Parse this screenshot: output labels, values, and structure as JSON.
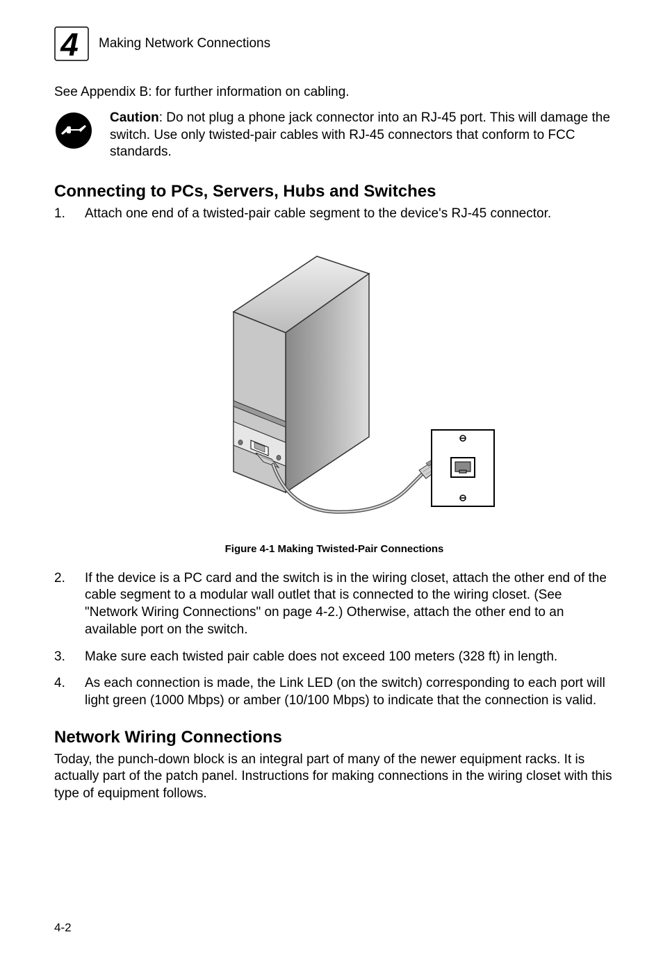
{
  "header": {
    "chapter_number": "4",
    "title": "Making Network Connections"
  },
  "intro": "See Appendix B: for further information on cabling.",
  "caution": {
    "label": "Caution",
    "text": ": Do not plug a phone jack connector into an RJ-45 port. This will damage the switch. Use only twisted-pair cables with RJ-45 connectors that conform to FCC standards."
  },
  "section1": {
    "heading": "Connecting to PCs, Servers, Hubs and Switches",
    "items": [
      {
        "num": "1.",
        "text": "Attach one end of a twisted-pair cable segment to the device's RJ-45 connector."
      },
      {
        "num": "2.",
        "text": "If the device is a PC card and the switch is in the wiring closet, attach the other end of the cable segment to a modular wall outlet that is connected to the wiring closet. (See \"Network Wiring Connections\" on page 4-2.) Otherwise, attach the other end to an available port on the switch."
      },
      {
        "num": "3.",
        "text": "Make sure each twisted pair cable does not exceed 100 meters (328 ft) in length."
      },
      {
        "num": "4.",
        "text": "As each connection is made, the Link LED (on the switch) corresponding to each port will light green (1000 Mbps) or amber (10/100 Mbps) to indicate that the connection is valid."
      }
    ]
  },
  "figure": {
    "caption": "Figure 4-1  Making Twisted-Pair Connections"
  },
  "section2": {
    "heading": "Network Wiring Connections",
    "para": "Today, the punch-down block is an integral part of many of the newer equipment racks. It is actually part of the patch panel. Instructions for making connections in the wiring closet with this type of equipment follows."
  },
  "page_number": "4-2"
}
